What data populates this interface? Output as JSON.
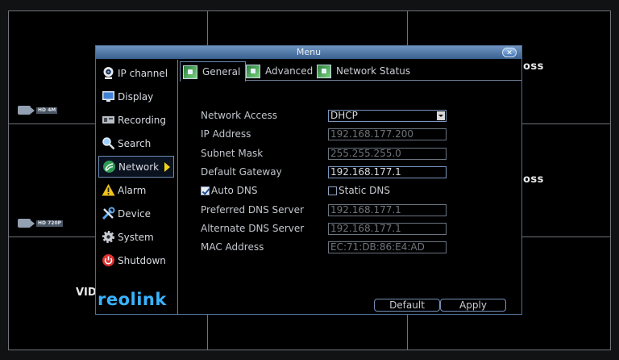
{
  "background": {
    "loss_texts": [
      "oss",
      "oss"
    ],
    "hd_badges": [
      "HD 4M",
      "HD 720P"
    ],
    "vid_text": "VID"
  },
  "window": {
    "title": "Menu",
    "close_glyph": "✕"
  },
  "sidebar": {
    "items": [
      {
        "label": "IP channel",
        "icon": "webcam-icon"
      },
      {
        "label": "Display",
        "icon": "monitor-icon"
      },
      {
        "label": "Recording",
        "icon": "recorder-icon"
      },
      {
        "label": "Search",
        "icon": "magnifier-icon"
      },
      {
        "label": "Network",
        "icon": "network-icon",
        "active": true
      },
      {
        "label": "Alarm",
        "icon": "warning-icon"
      },
      {
        "label": "Device",
        "icon": "tools-icon"
      },
      {
        "label": "System",
        "icon": "gear-icon"
      },
      {
        "label": "Shutdown",
        "icon": "power-icon"
      }
    ],
    "logo": "reolink"
  },
  "tabs": [
    {
      "label": "General",
      "active": true
    },
    {
      "label": "Advanced"
    },
    {
      "label": "Network Status"
    }
  ],
  "form": {
    "network_access_label": "Network Access",
    "network_access_value": "DHCP",
    "ip_address_label": "IP Address",
    "ip_address_value": "192.168.177.200",
    "subnet_mask_label": "Subnet Mask",
    "subnet_mask_value": "255.255.255.0",
    "default_gateway_label": "Default Gateway",
    "default_gateway_value": "192.168.177.1",
    "auto_dns_label": "Auto DNS",
    "auto_dns_checked": true,
    "static_dns_label": "Static DNS",
    "static_dns_checked": false,
    "preferred_dns_label": "Preferred DNS Server",
    "preferred_dns_value": "192.168.177.1",
    "alternate_dns_label": "Alternate DNS Server",
    "alternate_dns_value": "192.168.177.1",
    "mac_address_label": "MAC Address",
    "mac_address_value": "EC:71:DB:86:E4:AD"
  },
  "buttons": {
    "default_label": "Default",
    "apply_label": "Apply"
  },
  "colors": {
    "accent": "#3ab3ff",
    "arrow": "#f1d418",
    "titlebar": "#4f78a8"
  }
}
